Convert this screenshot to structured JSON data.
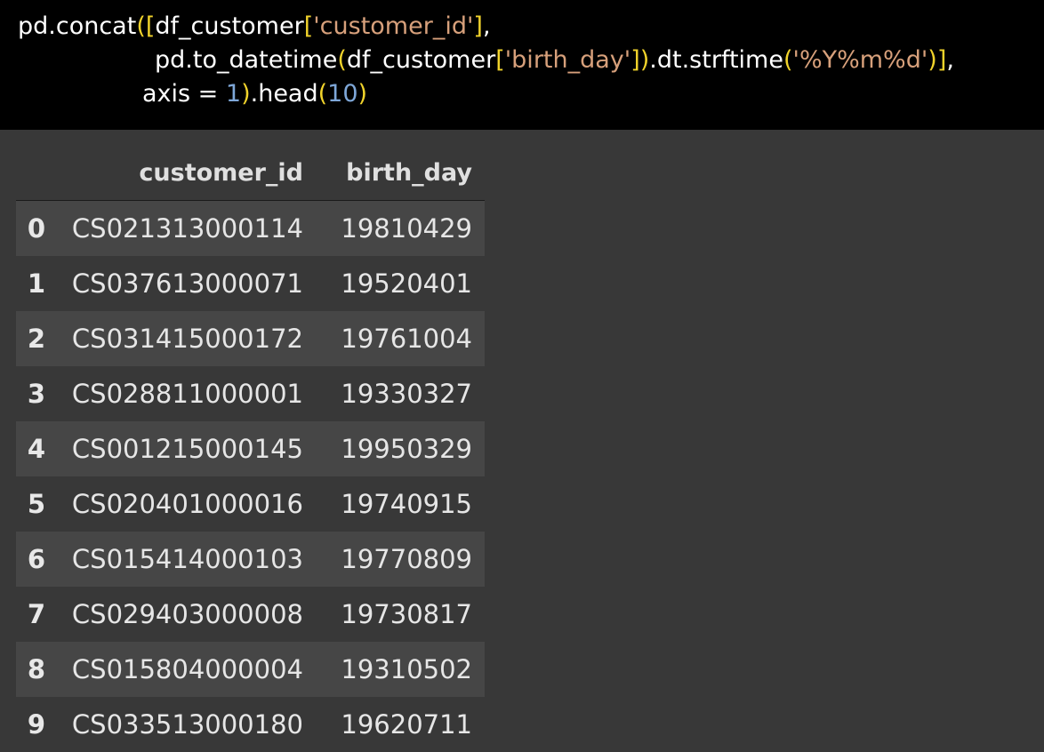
{
  "colors": {
    "code_background": "#000000",
    "output_background": "#383838",
    "string": "#d7a07b",
    "number": "#7ea7d8",
    "bracket": "#f1d32b",
    "row_stripe": "#464646"
  },
  "code": {
    "line1": {
      "t1": "pd.concat",
      "t2": "(",
      "t3": "[",
      "t4": "df_customer",
      "t5": "[",
      "t6": "'customer_id'",
      "t7": "]",
      "t8": ","
    },
    "line2": {
      "t1": "pd.to_datetime",
      "t2": "(",
      "t3": "df_customer",
      "t4": "[",
      "t5": "'birth_day'",
      "t6": "]",
      "t7": ")",
      "t8": ".dt.strftime",
      "t9": "(",
      "t10": "'%Y%m%d'",
      "t11": ")",
      "t12": "]",
      "t13": ","
    },
    "line3": {
      "t1": "axis = ",
      "t2": "1",
      "t3": ")",
      "t4": ".head",
      "t5": "(",
      "t6": "10",
      "t7": ")"
    }
  },
  "table": {
    "columns": [
      "customer_id",
      "birth_day"
    ],
    "rows": [
      {
        "index": "0",
        "customer_id": "CS021313000114",
        "birth_day": "19810429"
      },
      {
        "index": "1",
        "customer_id": "CS037613000071",
        "birth_day": "19520401"
      },
      {
        "index": "2",
        "customer_id": "CS031415000172",
        "birth_day": "19761004"
      },
      {
        "index": "3",
        "customer_id": "CS028811000001",
        "birth_day": "19330327"
      },
      {
        "index": "4",
        "customer_id": "CS001215000145",
        "birth_day": "19950329"
      },
      {
        "index": "5",
        "customer_id": "CS020401000016",
        "birth_day": "19740915"
      },
      {
        "index": "6",
        "customer_id": "CS015414000103",
        "birth_day": "19770809"
      },
      {
        "index": "7",
        "customer_id": "CS029403000008",
        "birth_day": "19730817"
      },
      {
        "index": "8",
        "customer_id": "CS015804000004",
        "birth_day": "19310502"
      },
      {
        "index": "9",
        "customer_id": "CS033513000180",
        "birth_day": "19620711"
      }
    ]
  }
}
